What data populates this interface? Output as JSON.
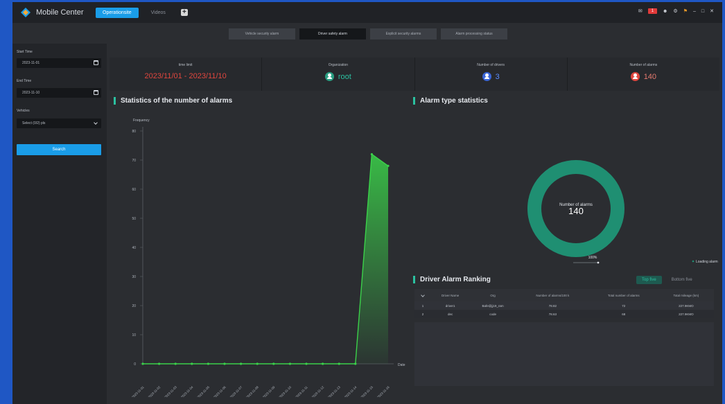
{
  "app": {
    "title": "Mobile Center"
  },
  "nav": {
    "active": "Operationsite",
    "item": "Videos",
    "add": "+"
  },
  "tray": {
    "badge": "1"
  },
  "tabs": [
    {
      "label": "Vehicle security alarm"
    },
    {
      "label": "Driver safety alarm"
    },
    {
      "label": "Explicit security alarms"
    },
    {
      "label": "Alarm processing status"
    }
  ],
  "sidebar": {
    "start_label": "Start Time",
    "start_value": "2023-11-01",
    "end_label": "End Time",
    "end_value": "2023-11-10",
    "vehicles_label": "Vehicles",
    "vehicles_value": "Select (0/2) pls",
    "search_label": "Search"
  },
  "summary": {
    "time_label": "time limit",
    "time_value": "2023/11/01 - 2023/11/10",
    "org_label": "Organization",
    "org_value": "root",
    "drivers_label": "Number of drivers",
    "drivers_value": "3",
    "alarms_label": "Number of alarms",
    "alarms_value": "140"
  },
  "sections": {
    "stats_title": "Statistics of the number of alarms",
    "type_title": "Alarm type statistics",
    "ranking_title": "Driver Alarm Ranking"
  },
  "donut": {
    "center_label": "Number of alarms",
    "center_value": "140",
    "percent_label": "100%",
    "legend": "Loading alarm",
    "color": "#1f8f72"
  },
  "ranking": {
    "buttons": [
      "Top five",
      "Bottom five"
    ],
    "headers": [
      "",
      "Driver Name",
      "Org",
      "Number of alarms/100 k",
      "Total number of alarms",
      "Total mileage (km)"
    ],
    "rows": [
      [
        "1",
        "driver1",
        "Bafe@jj19_ram",
        "78.82",
        "72",
        "227.9KMO"
      ],
      [
        "2",
        "dec",
        "code",
        "78.63",
        "68",
        "227.9KMO"
      ]
    ]
  },
  "chart_data": {
    "type": "area",
    "title": "Statistics of the number of alarms",
    "ylabel": "Frequency",
    "xlabel": "Date",
    "ylim": [
      0,
      80
    ],
    "yticks": [
      0,
      10,
      20,
      30,
      40,
      50,
      60,
      70,
      80
    ],
    "x": [
      "2023-11-01",
      "2023-11-02",
      "2023-11-03",
      "2023-11-04",
      "2023-11-05",
      "2023-11-06",
      "2023-11-07",
      "2023-11-08",
      "2023-11-09",
      "2023-11-10",
      "2023-11-11",
      "2023-11-12",
      "2023-11-13",
      "2023-11-14",
      "2023-11-15",
      "2023-11-16"
    ],
    "series": [
      {
        "values": [
          0,
          0,
          0,
          0,
          0,
          0,
          0,
          0,
          0,
          0,
          0,
          0,
          0,
          0,
          72,
          68
        ]
      }
    ],
    "grid": false,
    "color": "#3bd24a"
  }
}
